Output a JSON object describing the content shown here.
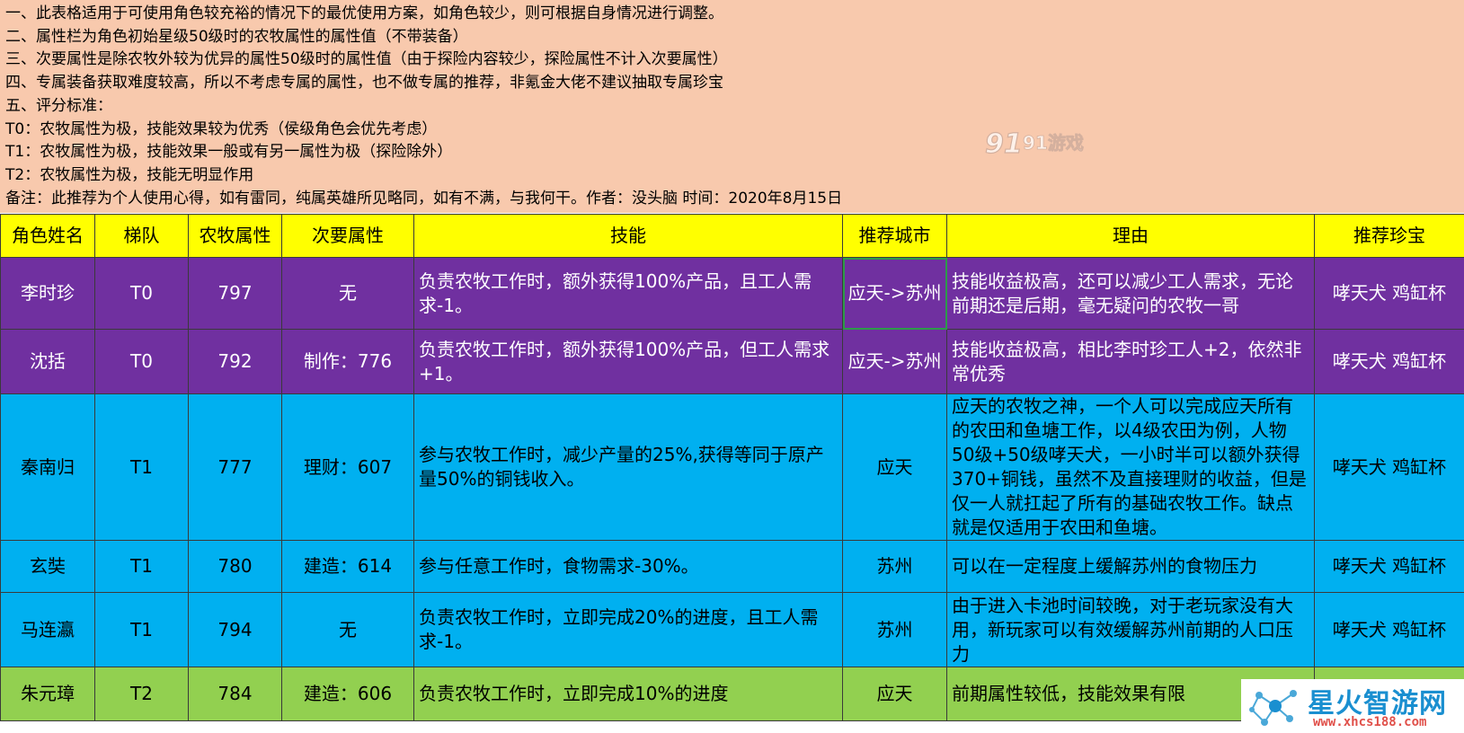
{
  "notes": [
    "一、此表格适用于可使用角色较充裕的情况下的最优使用方案，如角色较少，则可根据自身情况进行调整。",
    "二、属性栏为角色初始星级50级时的农牧属性的属性值（不带装备）",
    "三、次要属性是除农牧外较为优异的属性50级时的属性值（由于探险内容较少，探险属性不计入次要属性）",
    "四、专属装备获取难度较高，所以不考虑专属的属性，也不做专属的推荐，非氪金大佬不建议抽取专属珍宝",
    "五、评分标准：",
    "T0：农牧属性为极，技能效果较为优秀（侯级角色会优先考虑）",
    "T1：农牧属性为极，技能效果一般或有另一属性为极（探险除外）",
    "T2：农牧属性为极，技能无明显作用",
    "备注：此推荐为个人使用心得，如有雷同，纯属英雄所见略同，如有不满，与我何干。作者：没头脑 时间：2020年8月15日"
  ],
  "watermark_text": "91游戏",
  "headers": [
    "角色姓名",
    "梯队",
    "农牧属性",
    "次要属性",
    "技能",
    "推荐城市",
    "理由",
    "推荐珍宝"
  ],
  "rows": [
    {
      "name": "李时珍",
      "tier": "T0",
      "farm": "797",
      "secondary": "无",
      "skill": "负责农牧工作时，额外获得100%产品，且工人需求-1。",
      "city": "应天->苏州",
      "reason": "技能收益极高，还可以减少工人需求，无论前期还是后期，毫无疑问的农牧一哥",
      "treasure": "哮天犬 鸡缸杯"
    },
    {
      "name": "沈括",
      "tier": "T0",
      "farm": "792",
      "secondary": "制作：776",
      "skill": "负责农牧工作时，额外获得100%产品，但工人需求+1。",
      "city": "应天->苏州",
      "reason": "技能收益极高，相比李时珍工人+2，依然非常优秀",
      "treasure": "哮天犬 鸡缸杯"
    },
    {
      "name": "秦南归",
      "tier": "T1",
      "farm": "777",
      "secondary": "理财：607",
      "skill": "参与农牧工作时，减少产量的25%,获得等同于原产量50%的铜钱收入。",
      "city": "应天",
      "reason": "应天的农牧之神，一个人可以完成应天所有的农田和鱼塘工作，以4级农田为例，人物50级+50级哮天犬，一小时半可以额外获得370+铜钱，虽然不及直接理财的收益，但是仅一人就扛起了所有的基础农牧工作。缺点就是仅适用于农田和鱼塘。",
      "treasure": "哮天犬 鸡缸杯"
    },
    {
      "name": "玄奘",
      "tier": "T1",
      "farm": "780",
      "secondary": "建造：614",
      "skill": "参与任意工作时，食物需求-30%。",
      "city": "苏州",
      "reason": "可以在一定程度上缓解苏州的食物压力",
      "treasure": "哮天犬 鸡缸杯"
    },
    {
      "name": "马连瀛",
      "tier": "T1",
      "farm": "794",
      "secondary": "无",
      "skill": "负责农牧工作时，立即完成20%的进度，且工人需求-1。",
      "city": "苏州",
      "reason": "由于进入卡池时间较晚，对于老玩家没有大用，新玩家可以有效缓解苏州前期的人口压力",
      "treasure": "哮天犬 鸡缸杯"
    },
    {
      "name": "朱元璋",
      "tier": "T2",
      "farm": "784",
      "secondary": "建造：606",
      "skill": "负责农牧工作时，立即完成10%的进度",
      "city": "应天",
      "reason": "前期属性较低，技能效果有限",
      "treasure": ""
    }
  ],
  "brand": {
    "name": "星火智游网",
    "url": "www.xhcs188.com"
  },
  "colors": {
    "notes_bg": "#f8c9ad",
    "header_bg": "#ffff00",
    "t0_bg": "#7030a0",
    "t1_bg": "#00b0f0",
    "t2_bg": "#92d050"
  }
}
